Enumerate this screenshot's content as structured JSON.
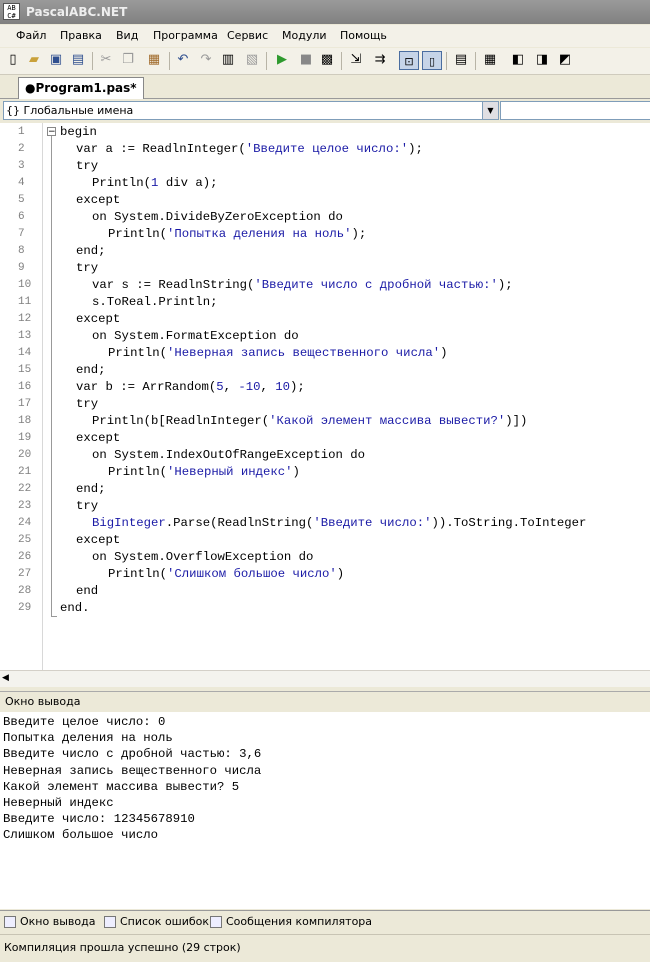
{
  "window": {
    "title": "PascalABC.NET",
    "icon_text": "AB C#"
  },
  "menu": [
    "Файл",
    "Правка",
    "Вид",
    "Программа",
    "Сервис",
    "Модули",
    "Помощь"
  ],
  "tab": {
    "label": "●Program1.pas*"
  },
  "names_combo": {
    "value": "{} Глобальные имена"
  },
  "code": {
    "line_numbers": [
      "1",
      "2",
      "3",
      "4",
      "5",
      "6",
      "7",
      "8",
      "9",
      "10",
      "11",
      "12",
      "13",
      "14",
      "15",
      "16",
      "17",
      "18",
      "19",
      "20",
      "21",
      "22",
      "23",
      "24",
      "25",
      "26",
      "27",
      "28",
      "29"
    ],
    "lines": [
      {
        "indent": 0,
        "parts": [
          {
            "t": "begin",
            "c": "kw"
          }
        ]
      },
      {
        "indent": 2,
        "parts": [
          {
            "t": "var a := ReadlnInteger(",
            "c": "kw"
          },
          {
            "t": "'Введите целое число:'",
            "c": "str"
          },
          {
            "t": ");",
            "c": "kw"
          }
        ]
      },
      {
        "indent": 2,
        "parts": [
          {
            "t": "try",
            "c": "kw"
          }
        ]
      },
      {
        "indent": 4,
        "parts": [
          {
            "t": "Println(",
            "c": "kw"
          },
          {
            "t": "1",
            "c": "num"
          },
          {
            "t": " div a);",
            "c": "kw"
          }
        ]
      },
      {
        "indent": 2,
        "parts": [
          {
            "t": "except",
            "c": "kw"
          }
        ]
      },
      {
        "indent": 4,
        "parts": [
          {
            "t": "on System.DivideByZeroException do",
            "c": "kw"
          }
        ]
      },
      {
        "indent": 6,
        "parts": [
          {
            "t": "Println(",
            "c": "kw"
          },
          {
            "t": "'Попытка деления на ноль'",
            "c": "str"
          },
          {
            "t": ");",
            "c": "kw"
          }
        ]
      },
      {
        "indent": 2,
        "parts": [
          {
            "t": "end;",
            "c": "kw"
          }
        ]
      },
      {
        "indent": 2,
        "parts": [
          {
            "t": "try",
            "c": "kw"
          }
        ]
      },
      {
        "indent": 4,
        "parts": [
          {
            "t": "var s := ReadlnString(",
            "c": "kw"
          },
          {
            "t": "'Введите число с дробной частью:'",
            "c": "str"
          },
          {
            "t": ");",
            "c": "kw"
          }
        ]
      },
      {
        "indent": 4,
        "parts": [
          {
            "t": "s.ToReal.Println;",
            "c": "kw"
          }
        ]
      },
      {
        "indent": 2,
        "parts": [
          {
            "t": "except",
            "c": "kw"
          }
        ]
      },
      {
        "indent": 4,
        "parts": [
          {
            "t": "on System.FormatException do",
            "c": "kw"
          }
        ]
      },
      {
        "indent": 6,
        "parts": [
          {
            "t": "Println(",
            "c": "kw"
          },
          {
            "t": "'Неверная запись вещественного числа'",
            "c": "str"
          },
          {
            "t": ")",
            "c": "kw"
          }
        ]
      },
      {
        "indent": 2,
        "parts": [
          {
            "t": "end;",
            "c": "kw"
          }
        ]
      },
      {
        "indent": 2,
        "parts": [
          {
            "t": "var b := ArrRandom(",
            "c": "kw"
          },
          {
            "t": "5",
            "c": "num"
          },
          {
            "t": ", ",
            "c": "kw"
          },
          {
            "t": "-10",
            "c": "num"
          },
          {
            "t": ", ",
            "c": "kw"
          },
          {
            "t": "10",
            "c": "num"
          },
          {
            "t": ");",
            "c": "kw"
          }
        ]
      },
      {
        "indent": 2,
        "parts": [
          {
            "t": "try",
            "c": "kw"
          }
        ]
      },
      {
        "indent": 4,
        "parts": [
          {
            "t": "Println(b[ReadlnInteger(",
            "c": "kw"
          },
          {
            "t": "'Какой элемент массива вывести?'",
            "c": "str"
          },
          {
            "t": ")])",
            "c": "kw"
          }
        ]
      },
      {
        "indent": 2,
        "parts": [
          {
            "t": "except",
            "c": "kw"
          }
        ]
      },
      {
        "indent": 4,
        "parts": [
          {
            "t": "on System.IndexOutOfRangeException do",
            "c": "kw"
          }
        ]
      },
      {
        "indent": 6,
        "parts": [
          {
            "t": "Println(",
            "c": "kw"
          },
          {
            "t": "'Неверный индекс'",
            "c": "str"
          },
          {
            "t": ")",
            "c": "kw"
          }
        ]
      },
      {
        "indent": 2,
        "parts": [
          {
            "t": "end;",
            "c": "kw"
          }
        ]
      },
      {
        "indent": 2,
        "parts": [
          {
            "t": "try",
            "c": "kw"
          }
        ]
      },
      {
        "indent": 4,
        "parts": [
          {
            "t": "BigInteger",
            "c": "str"
          },
          {
            "t": ".Parse(ReadlnString(",
            "c": "kw"
          },
          {
            "t": "'Введите число:'",
            "c": "str"
          },
          {
            "t": ")).ToString.ToInteger",
            "c": "kw"
          }
        ]
      },
      {
        "indent": 2,
        "parts": [
          {
            "t": "except",
            "c": "kw"
          }
        ]
      },
      {
        "indent": 4,
        "parts": [
          {
            "t": "on System.OverflowException do",
            "c": "kw"
          }
        ]
      },
      {
        "indent": 6,
        "parts": [
          {
            "t": "Println(",
            "c": "kw"
          },
          {
            "t": "'Слишком большое число'",
            "c": "str"
          },
          {
            "t": ")",
            "c": "kw"
          }
        ]
      },
      {
        "indent": 2,
        "parts": [
          {
            "t": "end",
            "c": "kw"
          }
        ]
      },
      {
        "indent": 0,
        "parts": [
          {
            "t": "end.",
            "c": "kw"
          }
        ]
      }
    ]
  },
  "output": {
    "header": "Окно вывода",
    "lines": [
      "Введите целое число: 0",
      "Попытка деления на ноль",
      "Введите число с дробной частью: 3,6",
      "Неверная запись вещественного числа",
      "Какой элемент массива вывести? 5",
      "Неверный индекс",
      "Введите число: 12345678910",
      "Слишком большое число"
    ]
  },
  "bottom_tabs": [
    "Окно вывода",
    "Список ошибок",
    "Сообщения компилятора"
  ],
  "status": "Компиляция прошла успешно (29 строк)",
  "colors": {
    "keyword": "#000000",
    "string": "#1a1aa6",
    "run_icon": "#2e9a2e"
  }
}
